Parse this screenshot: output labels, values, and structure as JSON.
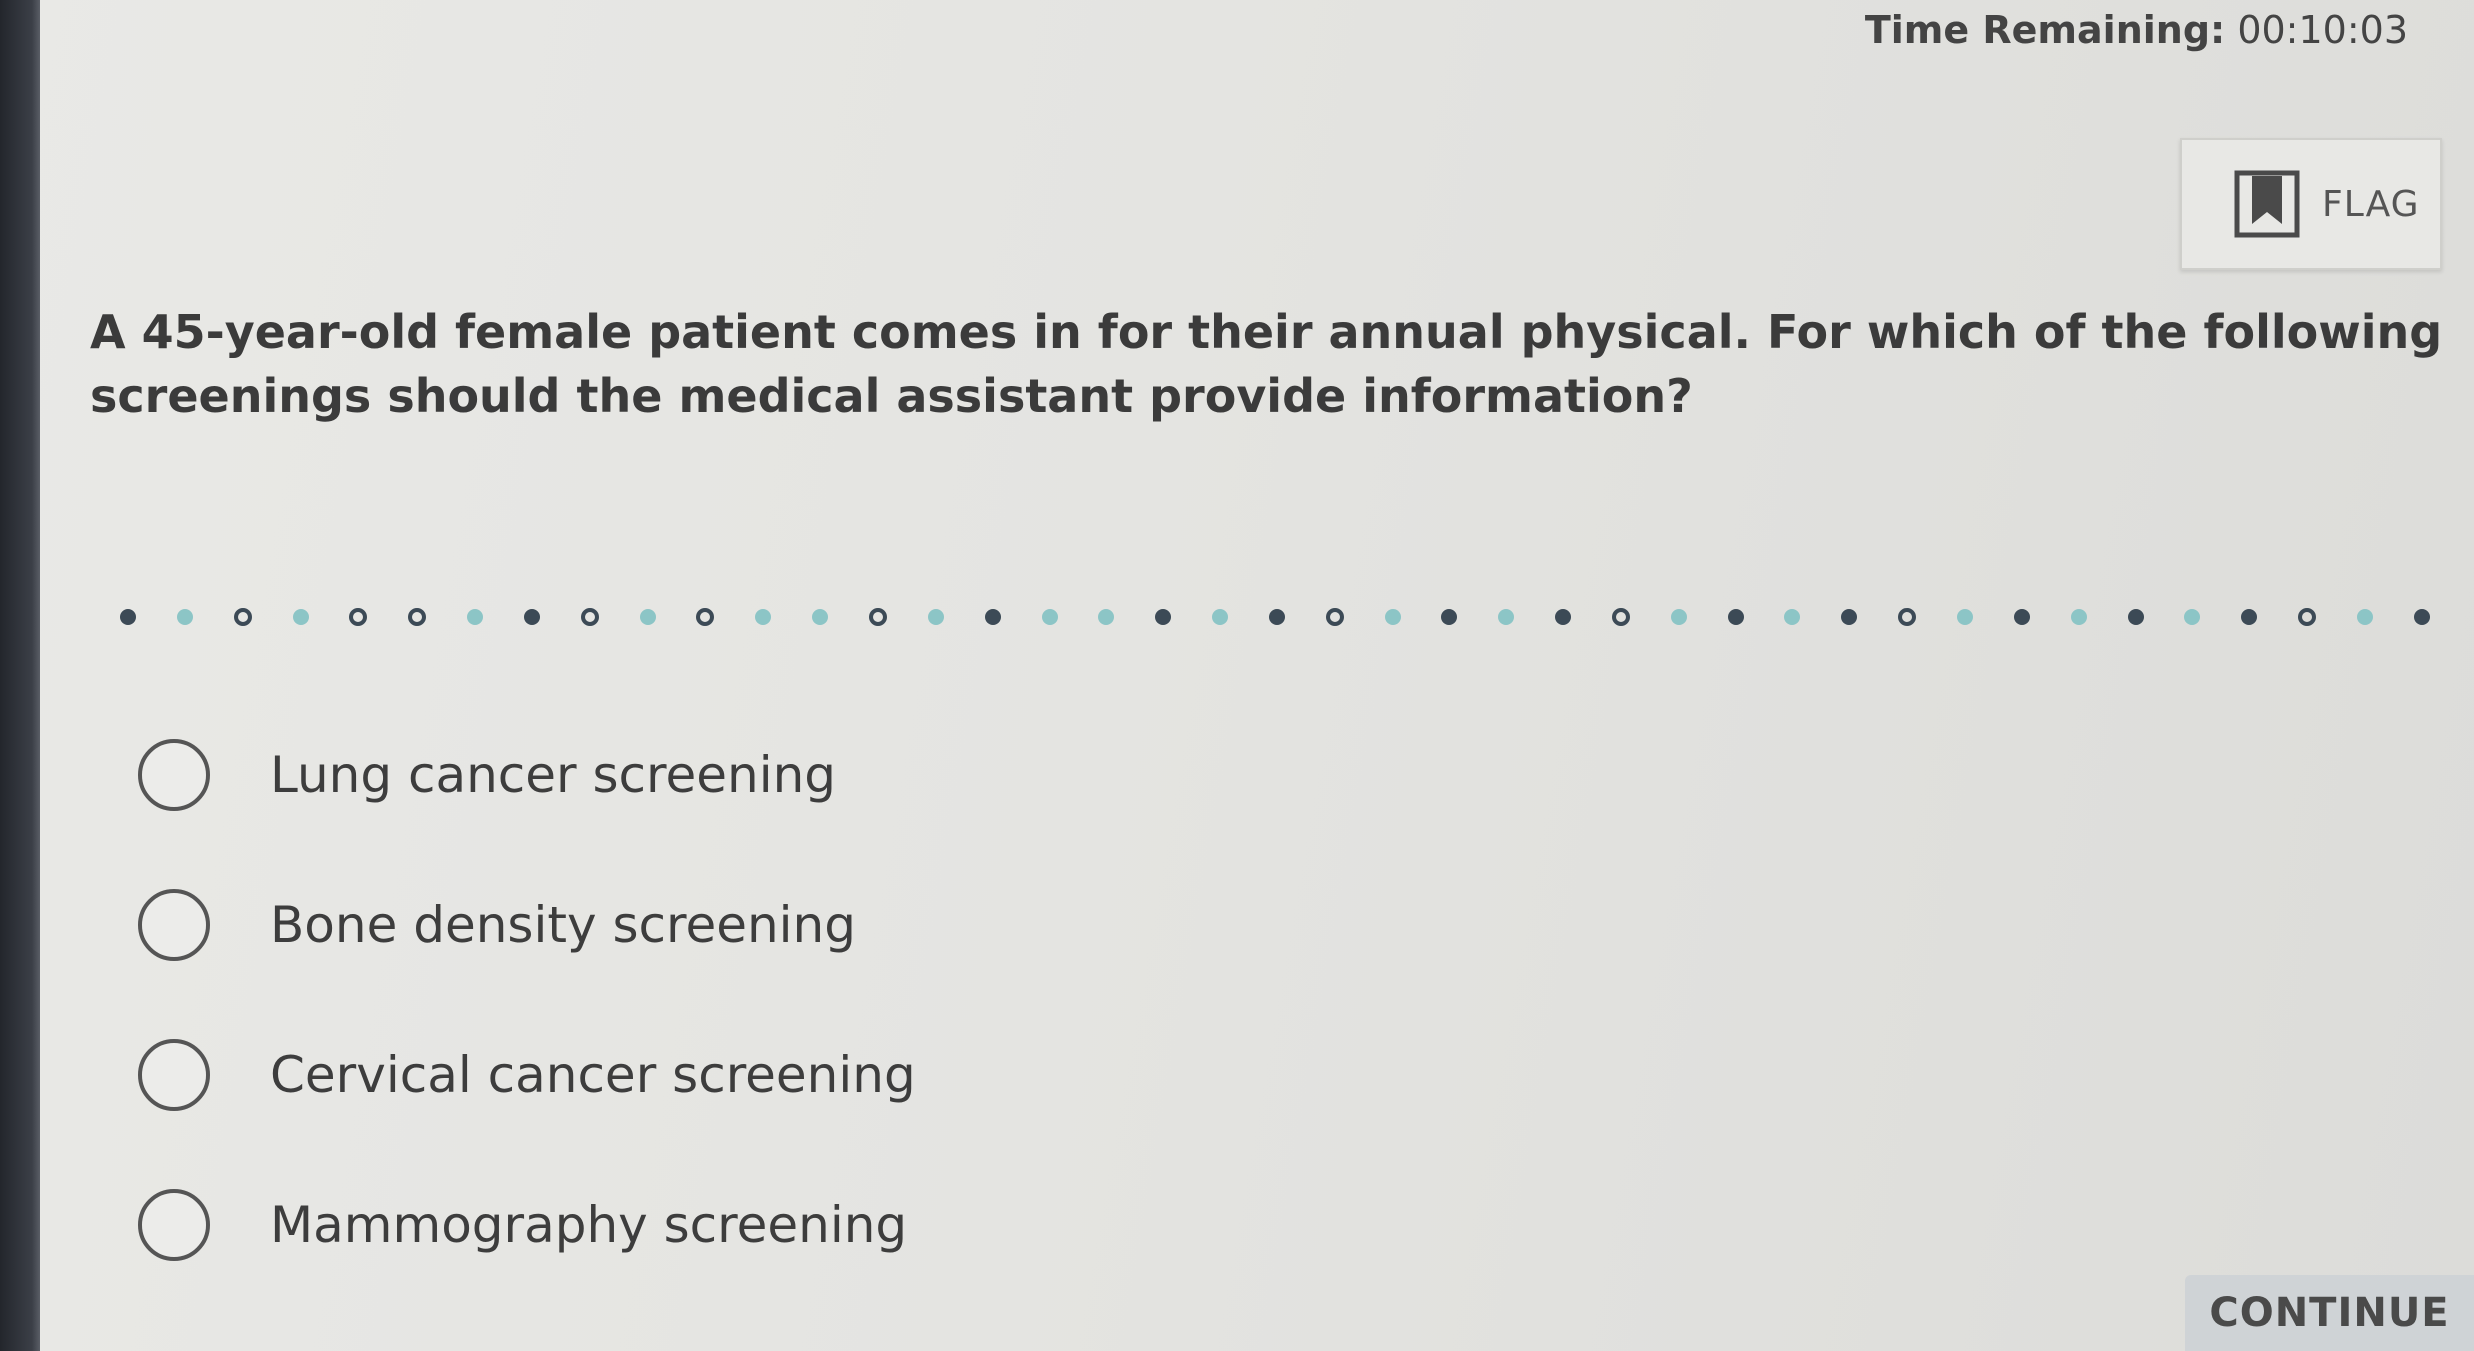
{
  "header": {
    "timer_label": "Time Remaining:",
    "timer_value": "00:10:03",
    "flag_label": "FLAG"
  },
  "question": {
    "text": "A 45-year-old female patient comes in for their annual physical. For which of the following screenings should the medical assistant provide information?"
  },
  "progress": {
    "dots": [
      "filled",
      "teal",
      "open",
      "teal",
      "open",
      "open",
      "teal",
      "filled",
      "open",
      "teal",
      "open",
      "teal",
      "teal",
      "open",
      "teal",
      "filled",
      "teal",
      "teal",
      "filled",
      "teal",
      "filled",
      "open",
      "teal",
      "filled",
      "teal",
      "filled",
      "open",
      "teal",
      "filled",
      "teal",
      "filled",
      "open",
      "teal",
      "filled",
      "teal",
      "filled",
      "teal",
      "filled",
      "open",
      "teal",
      "filled"
    ]
  },
  "options": [
    {
      "label": "Lung cancer screening"
    },
    {
      "label": "Bone density screening"
    },
    {
      "label": "Cervical cancer screening"
    },
    {
      "label": "Mammography screening"
    }
  ],
  "footer": {
    "continue_label": "CONTINUE"
  },
  "colors": {
    "dot_dark": "#3c4a56",
    "dot_teal": "#8cc5c6",
    "background": "#e6e6e3"
  },
  "icons": {
    "flag": "bookmark-icon",
    "radio": "radio-circle-icon"
  }
}
